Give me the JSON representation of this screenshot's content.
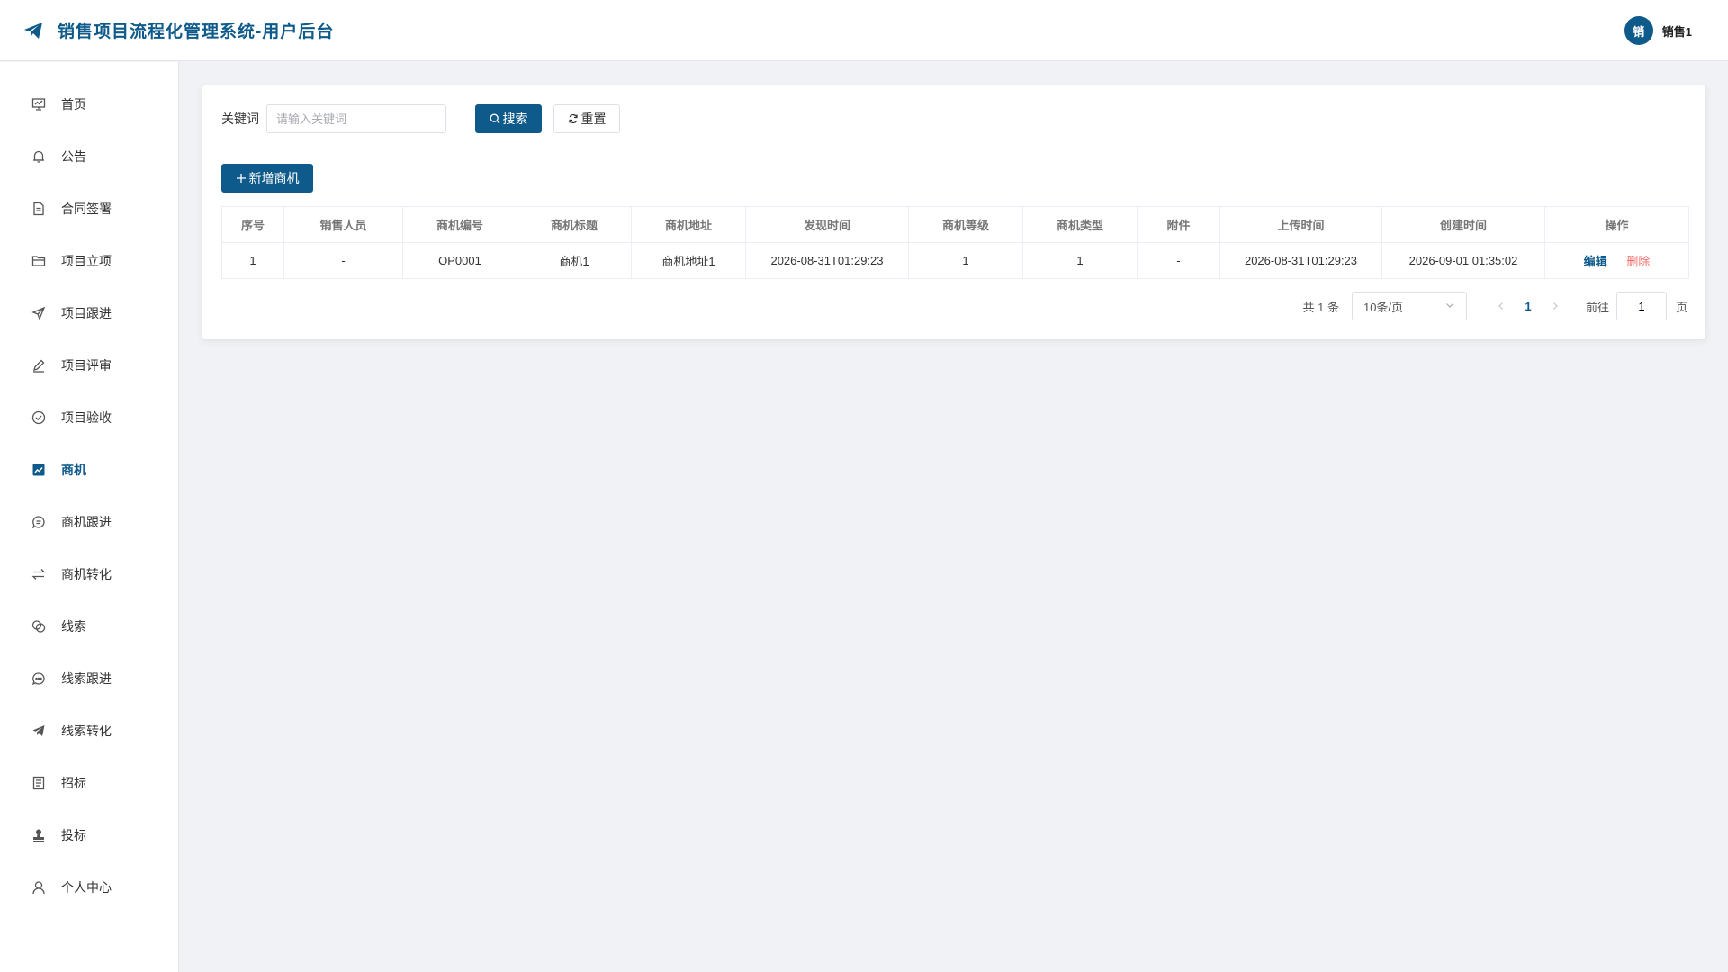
{
  "header": {
    "title": "销售项目流程化管理系统-用户后台",
    "avatar_text": "销",
    "username": "销售1"
  },
  "sidebar": {
    "items": [
      {
        "label": "首页",
        "icon": "chart-board-icon"
      },
      {
        "label": "公告",
        "icon": "bell-icon"
      },
      {
        "label": "合同签署",
        "icon": "document-icon"
      },
      {
        "label": "项目立项",
        "icon": "folder-icon"
      },
      {
        "label": "项目跟进",
        "icon": "send-icon"
      },
      {
        "label": "项目评审",
        "icon": "pen-icon"
      },
      {
        "label": "项目验收",
        "icon": "check-circle-icon"
      },
      {
        "label": "商机",
        "icon": "trend-chart-icon",
        "active": true
      },
      {
        "label": "商机跟进",
        "icon": "chat-icon"
      },
      {
        "label": "商机转化",
        "icon": "switch-icon"
      },
      {
        "label": "线索",
        "icon": "link-circles-icon"
      },
      {
        "label": "线索跟进",
        "icon": "chat-dots-icon"
      },
      {
        "label": "线索转化",
        "icon": "paper-plane-icon"
      },
      {
        "label": "招标",
        "icon": "tickets-icon"
      },
      {
        "label": "投标",
        "icon": "stamp-icon"
      },
      {
        "label": "个人中心",
        "icon": "user-icon"
      }
    ]
  },
  "search": {
    "label": "关键词",
    "placeholder": "请输入关键词",
    "value": "",
    "search_label": "搜索",
    "reset_label": "重置"
  },
  "toolbar": {
    "add_label": "新增商机"
  },
  "table": {
    "columns": [
      "序号",
      "销售人员",
      "商机编号",
      "商机标题",
      "商机地址",
      "发现时间",
      "商机等级",
      "商机类型",
      "附件",
      "上传时间",
      "创建时间",
      "操作"
    ],
    "rows": [
      [
        "1",
        "-",
        "OP0001",
        "商机1",
        "商机地址1",
        "2026-08-31T01:29:23",
        "1",
        "1",
        "-",
        "2026-08-31T01:29:23",
        "2026-09-01 01:35:02"
      ]
    ],
    "actions": {
      "edit": "编辑",
      "delete": "删除"
    }
  },
  "pagination": {
    "total_text": "共 1 条",
    "page_size": "10条/页",
    "current_page": "1",
    "goto_label": "前往",
    "goto_value": "1",
    "page_unit": "页"
  },
  "colors": {
    "primary": "#0e5a8a",
    "danger": "#f56c6c",
    "background": "#f0f2f5"
  }
}
